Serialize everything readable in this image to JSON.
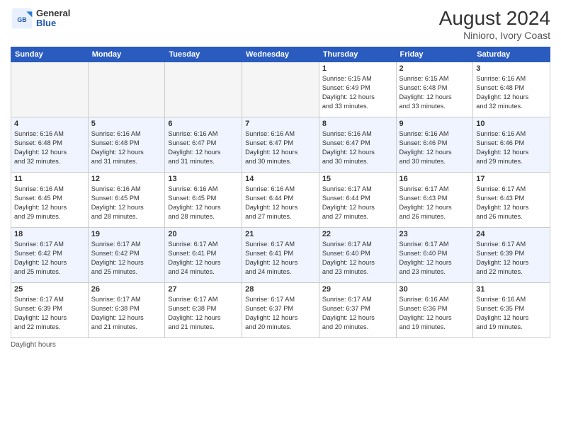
{
  "header": {
    "logo_general": "General",
    "logo_blue": "Blue",
    "month_year": "August 2024",
    "location": "Ninioro, Ivory Coast"
  },
  "weekdays": [
    "Sunday",
    "Monday",
    "Tuesday",
    "Wednesday",
    "Thursday",
    "Friday",
    "Saturday"
  ],
  "weeks": [
    [
      {
        "day": "",
        "info": ""
      },
      {
        "day": "",
        "info": ""
      },
      {
        "day": "",
        "info": ""
      },
      {
        "day": "",
        "info": ""
      },
      {
        "day": "1",
        "info": "Sunrise: 6:15 AM\nSunset: 6:49 PM\nDaylight: 12 hours\nand 33 minutes."
      },
      {
        "day": "2",
        "info": "Sunrise: 6:15 AM\nSunset: 6:48 PM\nDaylight: 12 hours\nand 33 minutes."
      },
      {
        "day": "3",
        "info": "Sunrise: 6:16 AM\nSunset: 6:48 PM\nDaylight: 12 hours\nand 32 minutes."
      }
    ],
    [
      {
        "day": "4",
        "info": "Sunrise: 6:16 AM\nSunset: 6:48 PM\nDaylight: 12 hours\nand 32 minutes."
      },
      {
        "day": "5",
        "info": "Sunrise: 6:16 AM\nSunset: 6:48 PM\nDaylight: 12 hours\nand 31 minutes."
      },
      {
        "day": "6",
        "info": "Sunrise: 6:16 AM\nSunset: 6:47 PM\nDaylight: 12 hours\nand 31 minutes."
      },
      {
        "day": "7",
        "info": "Sunrise: 6:16 AM\nSunset: 6:47 PM\nDaylight: 12 hours\nand 30 minutes."
      },
      {
        "day": "8",
        "info": "Sunrise: 6:16 AM\nSunset: 6:47 PM\nDaylight: 12 hours\nand 30 minutes."
      },
      {
        "day": "9",
        "info": "Sunrise: 6:16 AM\nSunset: 6:46 PM\nDaylight: 12 hours\nand 30 minutes."
      },
      {
        "day": "10",
        "info": "Sunrise: 6:16 AM\nSunset: 6:46 PM\nDaylight: 12 hours\nand 29 minutes."
      }
    ],
    [
      {
        "day": "11",
        "info": "Sunrise: 6:16 AM\nSunset: 6:45 PM\nDaylight: 12 hours\nand 29 minutes."
      },
      {
        "day": "12",
        "info": "Sunrise: 6:16 AM\nSunset: 6:45 PM\nDaylight: 12 hours\nand 28 minutes."
      },
      {
        "day": "13",
        "info": "Sunrise: 6:16 AM\nSunset: 6:45 PM\nDaylight: 12 hours\nand 28 minutes."
      },
      {
        "day": "14",
        "info": "Sunrise: 6:16 AM\nSunset: 6:44 PM\nDaylight: 12 hours\nand 27 minutes."
      },
      {
        "day": "15",
        "info": "Sunrise: 6:17 AM\nSunset: 6:44 PM\nDaylight: 12 hours\nand 27 minutes."
      },
      {
        "day": "16",
        "info": "Sunrise: 6:17 AM\nSunset: 6:43 PM\nDaylight: 12 hours\nand 26 minutes."
      },
      {
        "day": "17",
        "info": "Sunrise: 6:17 AM\nSunset: 6:43 PM\nDaylight: 12 hours\nand 26 minutes."
      }
    ],
    [
      {
        "day": "18",
        "info": "Sunrise: 6:17 AM\nSunset: 6:42 PM\nDaylight: 12 hours\nand 25 minutes."
      },
      {
        "day": "19",
        "info": "Sunrise: 6:17 AM\nSunset: 6:42 PM\nDaylight: 12 hours\nand 25 minutes."
      },
      {
        "day": "20",
        "info": "Sunrise: 6:17 AM\nSunset: 6:41 PM\nDaylight: 12 hours\nand 24 minutes."
      },
      {
        "day": "21",
        "info": "Sunrise: 6:17 AM\nSunset: 6:41 PM\nDaylight: 12 hours\nand 24 minutes."
      },
      {
        "day": "22",
        "info": "Sunrise: 6:17 AM\nSunset: 6:40 PM\nDaylight: 12 hours\nand 23 minutes."
      },
      {
        "day": "23",
        "info": "Sunrise: 6:17 AM\nSunset: 6:40 PM\nDaylight: 12 hours\nand 23 minutes."
      },
      {
        "day": "24",
        "info": "Sunrise: 6:17 AM\nSunset: 6:39 PM\nDaylight: 12 hours\nand 22 minutes."
      }
    ],
    [
      {
        "day": "25",
        "info": "Sunrise: 6:17 AM\nSunset: 6:39 PM\nDaylight: 12 hours\nand 22 minutes."
      },
      {
        "day": "26",
        "info": "Sunrise: 6:17 AM\nSunset: 6:38 PM\nDaylight: 12 hours\nand 21 minutes."
      },
      {
        "day": "27",
        "info": "Sunrise: 6:17 AM\nSunset: 6:38 PM\nDaylight: 12 hours\nand 21 minutes."
      },
      {
        "day": "28",
        "info": "Sunrise: 6:17 AM\nSunset: 6:37 PM\nDaylight: 12 hours\nand 20 minutes."
      },
      {
        "day": "29",
        "info": "Sunrise: 6:17 AM\nSunset: 6:37 PM\nDaylight: 12 hours\nand 20 minutes."
      },
      {
        "day": "30",
        "info": "Sunrise: 6:16 AM\nSunset: 6:36 PM\nDaylight: 12 hours\nand 19 minutes."
      },
      {
        "day": "31",
        "info": "Sunrise: 6:16 AM\nSunset: 6:35 PM\nDaylight: 12 hours\nand 19 minutes."
      }
    ]
  ],
  "legend": {
    "daylight_label": "Daylight hours"
  }
}
